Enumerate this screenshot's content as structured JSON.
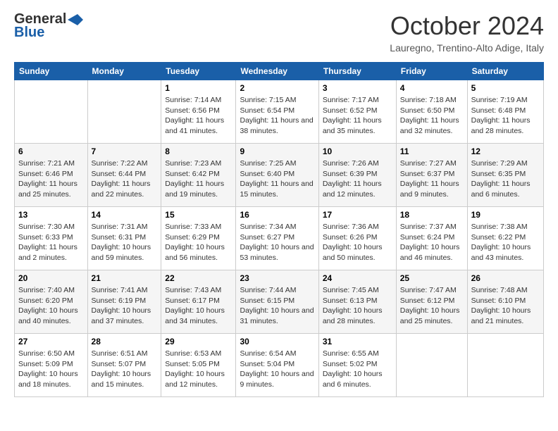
{
  "header": {
    "logo_general": "General",
    "logo_blue": "Blue",
    "month_year": "October 2024",
    "location": "Lauregno, Trentino-Alto Adige, Italy"
  },
  "days_of_week": [
    "Sunday",
    "Monday",
    "Tuesday",
    "Wednesday",
    "Thursday",
    "Friday",
    "Saturday"
  ],
  "weeks": [
    [
      {
        "day": "",
        "info": ""
      },
      {
        "day": "",
        "info": ""
      },
      {
        "day": "1",
        "info": "Sunrise: 7:14 AM\nSunset: 6:56 PM\nDaylight: 11 hours and 41 minutes."
      },
      {
        "day": "2",
        "info": "Sunrise: 7:15 AM\nSunset: 6:54 PM\nDaylight: 11 hours and 38 minutes."
      },
      {
        "day": "3",
        "info": "Sunrise: 7:17 AM\nSunset: 6:52 PM\nDaylight: 11 hours and 35 minutes."
      },
      {
        "day": "4",
        "info": "Sunrise: 7:18 AM\nSunset: 6:50 PM\nDaylight: 11 hours and 32 minutes."
      },
      {
        "day": "5",
        "info": "Sunrise: 7:19 AM\nSunset: 6:48 PM\nDaylight: 11 hours and 28 minutes."
      }
    ],
    [
      {
        "day": "6",
        "info": "Sunrise: 7:21 AM\nSunset: 6:46 PM\nDaylight: 11 hours and 25 minutes."
      },
      {
        "day": "7",
        "info": "Sunrise: 7:22 AM\nSunset: 6:44 PM\nDaylight: 11 hours and 22 minutes."
      },
      {
        "day": "8",
        "info": "Sunrise: 7:23 AM\nSunset: 6:42 PM\nDaylight: 11 hours and 19 minutes."
      },
      {
        "day": "9",
        "info": "Sunrise: 7:25 AM\nSunset: 6:40 PM\nDaylight: 11 hours and 15 minutes."
      },
      {
        "day": "10",
        "info": "Sunrise: 7:26 AM\nSunset: 6:39 PM\nDaylight: 11 hours and 12 minutes."
      },
      {
        "day": "11",
        "info": "Sunrise: 7:27 AM\nSunset: 6:37 PM\nDaylight: 11 hours and 9 minutes."
      },
      {
        "day": "12",
        "info": "Sunrise: 7:29 AM\nSunset: 6:35 PM\nDaylight: 11 hours and 6 minutes."
      }
    ],
    [
      {
        "day": "13",
        "info": "Sunrise: 7:30 AM\nSunset: 6:33 PM\nDaylight: 11 hours and 2 minutes."
      },
      {
        "day": "14",
        "info": "Sunrise: 7:31 AM\nSunset: 6:31 PM\nDaylight: 10 hours and 59 minutes."
      },
      {
        "day": "15",
        "info": "Sunrise: 7:33 AM\nSunset: 6:29 PM\nDaylight: 10 hours and 56 minutes."
      },
      {
        "day": "16",
        "info": "Sunrise: 7:34 AM\nSunset: 6:27 PM\nDaylight: 10 hours and 53 minutes."
      },
      {
        "day": "17",
        "info": "Sunrise: 7:36 AM\nSunset: 6:26 PM\nDaylight: 10 hours and 50 minutes."
      },
      {
        "day": "18",
        "info": "Sunrise: 7:37 AM\nSunset: 6:24 PM\nDaylight: 10 hours and 46 minutes."
      },
      {
        "day": "19",
        "info": "Sunrise: 7:38 AM\nSunset: 6:22 PM\nDaylight: 10 hours and 43 minutes."
      }
    ],
    [
      {
        "day": "20",
        "info": "Sunrise: 7:40 AM\nSunset: 6:20 PM\nDaylight: 10 hours and 40 minutes."
      },
      {
        "day": "21",
        "info": "Sunrise: 7:41 AM\nSunset: 6:19 PM\nDaylight: 10 hours and 37 minutes."
      },
      {
        "day": "22",
        "info": "Sunrise: 7:43 AM\nSunset: 6:17 PM\nDaylight: 10 hours and 34 minutes."
      },
      {
        "day": "23",
        "info": "Sunrise: 7:44 AM\nSunset: 6:15 PM\nDaylight: 10 hours and 31 minutes."
      },
      {
        "day": "24",
        "info": "Sunrise: 7:45 AM\nSunset: 6:13 PM\nDaylight: 10 hours and 28 minutes."
      },
      {
        "day": "25",
        "info": "Sunrise: 7:47 AM\nSunset: 6:12 PM\nDaylight: 10 hours and 25 minutes."
      },
      {
        "day": "26",
        "info": "Sunrise: 7:48 AM\nSunset: 6:10 PM\nDaylight: 10 hours and 21 minutes."
      }
    ],
    [
      {
        "day": "27",
        "info": "Sunrise: 6:50 AM\nSunset: 5:09 PM\nDaylight: 10 hours and 18 minutes."
      },
      {
        "day": "28",
        "info": "Sunrise: 6:51 AM\nSunset: 5:07 PM\nDaylight: 10 hours and 15 minutes."
      },
      {
        "day": "29",
        "info": "Sunrise: 6:53 AM\nSunset: 5:05 PM\nDaylight: 10 hours and 12 minutes."
      },
      {
        "day": "30",
        "info": "Sunrise: 6:54 AM\nSunset: 5:04 PM\nDaylight: 10 hours and 9 minutes."
      },
      {
        "day": "31",
        "info": "Sunrise: 6:55 AM\nSunset: 5:02 PM\nDaylight: 10 hours and 6 minutes."
      },
      {
        "day": "",
        "info": ""
      },
      {
        "day": "",
        "info": ""
      }
    ]
  ]
}
